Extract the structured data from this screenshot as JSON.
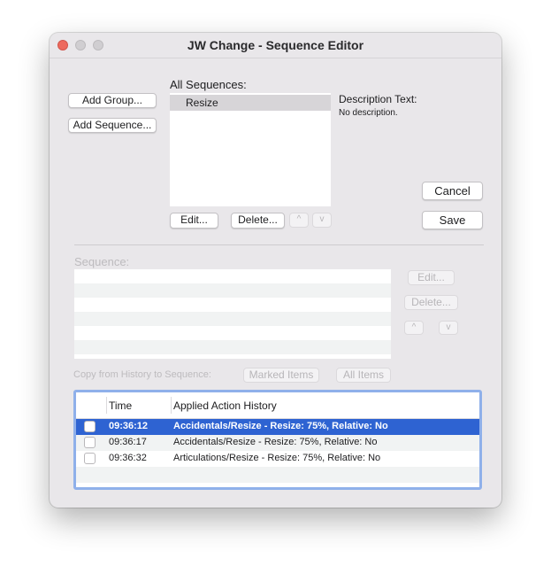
{
  "window": {
    "title": "JW Change - Sequence Editor"
  },
  "buttons": {
    "add_group": "Add Group...",
    "add_sequence": "Add Sequence...",
    "edit": "Edit...",
    "delete": "Delete...",
    "move_up": "^",
    "move_down": "v",
    "cancel": "Cancel",
    "save": "Save"
  },
  "all_sequences": {
    "label": "All Sequences:",
    "items": [
      {
        "label": "Resize",
        "selected": true
      }
    ]
  },
  "description": {
    "label": "Description Text:",
    "text": "No description."
  },
  "sequence_section": {
    "label": "Sequence:",
    "enabled": false,
    "buttons": {
      "edit": "Edit...",
      "delete": "Delete...",
      "move_up": "^",
      "move_down": "v"
    }
  },
  "copy_from_history": {
    "label": "Copy from History to Sequence:",
    "marked_items": "Marked Items",
    "all_items": "All Items"
  },
  "history": {
    "columns": [
      "Time",
      "Applied Action History"
    ],
    "rows": [
      {
        "time": "09:36:12",
        "action": "Accidentals/Resize - Resize: 75%, Relative: No",
        "checked": false,
        "selected": true
      },
      {
        "time": "09:36:17",
        "action": "Accidentals/Resize - Resize: 75%, Relative: No",
        "checked": false,
        "selected": false
      },
      {
        "time": "09:36:32",
        "action": "Articulations/Resize - Resize: 75%, Relative: No",
        "checked": false,
        "selected": false
      }
    ]
  },
  "colors": {
    "selection": "#2e63d2",
    "focus_ring": "#8fb0ea",
    "close_button": "#ed6a5e"
  }
}
